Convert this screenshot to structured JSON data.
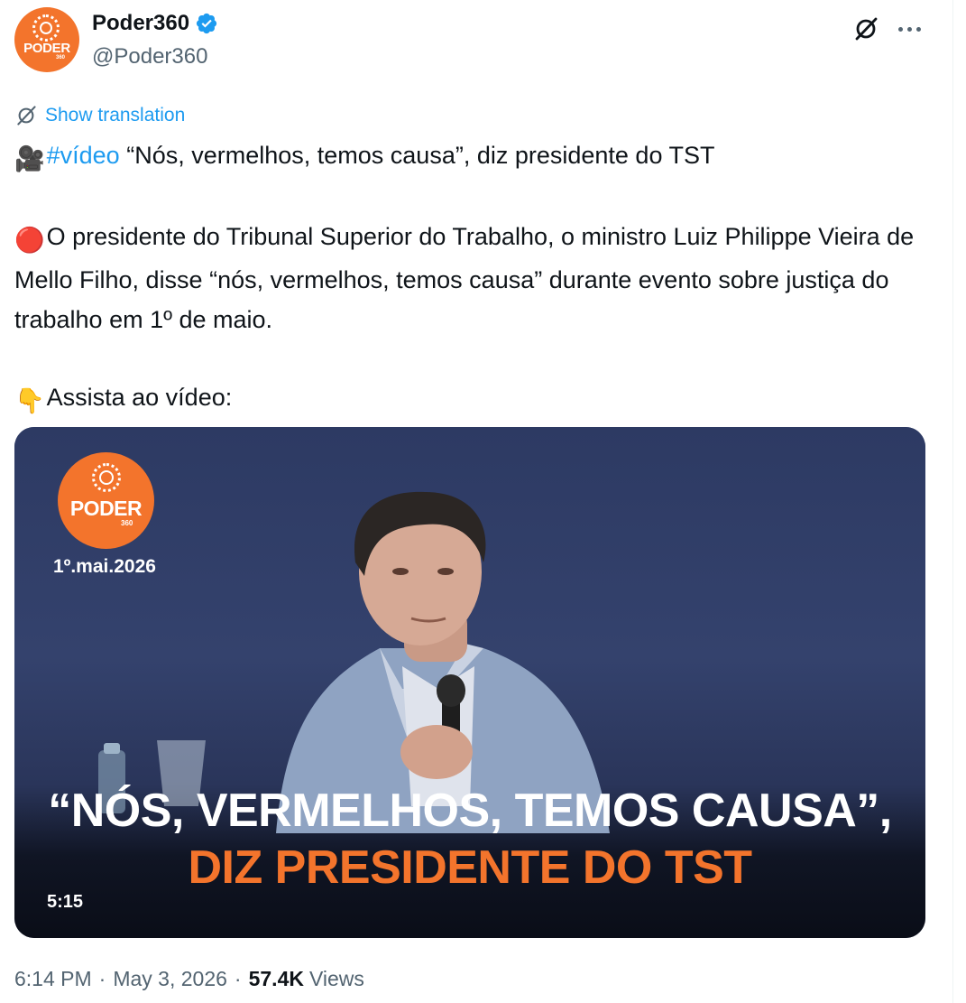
{
  "author": {
    "display_name": "Poder360",
    "handle": "@Poder360",
    "avatar_text": "PODER",
    "avatar_subtext": "360",
    "verified": true,
    "verified_color": "#1d9bf0"
  },
  "actions": {
    "grok_icon": "grok-icon",
    "more_icon": "more-icon"
  },
  "translation": {
    "label": "Show translation"
  },
  "tweet": {
    "line1_emoji": "🎥",
    "line1_hashtag": "#vídeo",
    "line1_text": " “Nós, vermelhos, temos causa”, diz presidente do TST",
    "para2_emoji": "🔴",
    "para2_text": "O presidente do Tribunal Superior do Trabalho, o ministro Luiz Philippe Vieira de Mello Filho, disse “nós, vermelhos, temos causa” durante evento sobre justiça do trabalho em 1º de maio.",
    "para3_emoji": "👇",
    "para3_text": "Assista ao vídeo:"
  },
  "media": {
    "logo_text": "PODER",
    "logo_subtext": "360",
    "date": "1º.mai.2026",
    "caption_line1": "“NÓS, VERMELHOS, TEMOS CAUSA”,",
    "caption_line2": "DIZ PRESIDENTE DO TST",
    "duration": "5:15",
    "brand_color": "#f3742c"
  },
  "meta": {
    "time": "6:14 PM",
    "date": "May 3, 2026",
    "views_count": "57.4K",
    "views_label": "Views"
  }
}
